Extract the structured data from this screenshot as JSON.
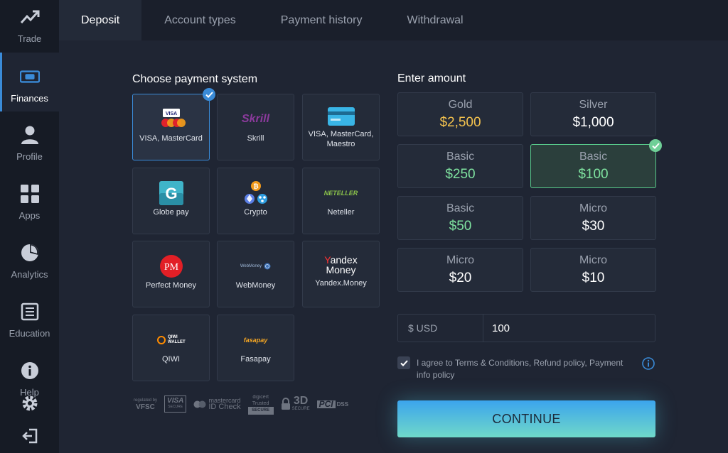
{
  "sidebar": {
    "items": [
      {
        "label": "Trade",
        "icon": "trend-up-icon"
      },
      {
        "label": "Finances",
        "icon": "banknote-icon",
        "active": true
      },
      {
        "label": "Profile",
        "icon": "person-icon"
      },
      {
        "label": "Apps",
        "icon": "grid-icon"
      },
      {
        "label": "Analytics",
        "icon": "pie-chart-icon"
      },
      {
        "label": "Education",
        "icon": "book-icon"
      },
      {
        "label": "Help",
        "icon": "info-circle-icon"
      }
    ],
    "extra_icons": [
      "gear-icon",
      "logout-icon"
    ]
  },
  "tabs": [
    {
      "label": "Deposit",
      "active": true
    },
    {
      "label": "Account types"
    },
    {
      "label": "Payment history"
    },
    {
      "label": "Withdrawal"
    }
  ],
  "payment": {
    "title": "Choose payment system",
    "methods": [
      {
        "label": "VISA, MasterCard",
        "logo_text": "VISA",
        "selected": true
      },
      {
        "label": "Skrill",
        "logo_text": "Skrill"
      },
      {
        "label": "VISA, MasterCard, Maestro"
      },
      {
        "label": "Globe pay",
        "logo_text": "G"
      },
      {
        "label": "Crypto"
      },
      {
        "label": "Neteller",
        "logo_text": "NETELLER"
      },
      {
        "label": "Perfect Money",
        "logo_text": "PM"
      },
      {
        "label": "WebMoney",
        "logo_text": "WebMoney"
      },
      {
        "label": "Yandex.Money",
        "logo_text_1": "Yandex",
        "logo_text_2": "Money"
      },
      {
        "label": "QIWI",
        "logo_text": "QIWI WALLET"
      },
      {
        "label": "Fasapay",
        "logo_text": "fasapay"
      }
    ]
  },
  "amount": {
    "title": "Enter amount",
    "options": [
      {
        "tier": "Gold",
        "value": "$2,500",
        "color": "#f2c14e"
      },
      {
        "tier": "Silver",
        "value": "$1,000",
        "color": "#ffffff"
      },
      {
        "tier": "Basic",
        "value": "$250",
        "color": "#7fe3a0"
      },
      {
        "tier": "Basic",
        "value": "$100",
        "color": "#7fe3a0",
        "selected": true
      },
      {
        "tier": "Basic",
        "value": "$50",
        "color": "#7fe3a0"
      },
      {
        "tier": "Micro",
        "value": "$30",
        "color": "#ffffff"
      },
      {
        "tier": "Micro",
        "value": "$20",
        "color": "#ffffff"
      },
      {
        "tier": "Micro",
        "value": "$10",
        "color": "#ffffff"
      }
    ],
    "currency_label": "$ USD",
    "input_value": "100"
  },
  "agreement": {
    "checked": true,
    "text": "I agree to Terms & Conditions, Refund policy, Payment info policy"
  },
  "continue_label": "CONTINUE",
  "security_badges": {
    "vfsc_top": "regulated by",
    "vfsc": "VFSC",
    "visa": "VISA",
    "visa_sub": "SECURE",
    "mastercard": "mastercard",
    "mastercard_sub": "ID Check",
    "digicert": "digicert Trusted",
    "digicert_sub": "SECURE",
    "three_d": "3D",
    "three_d_sub": "SECURE",
    "pci": "PCI",
    "dss": "DSS"
  },
  "colors": {
    "accent": "#3a8bd8",
    "selected_green": "#58c98b",
    "gold": "#f2c14e"
  }
}
